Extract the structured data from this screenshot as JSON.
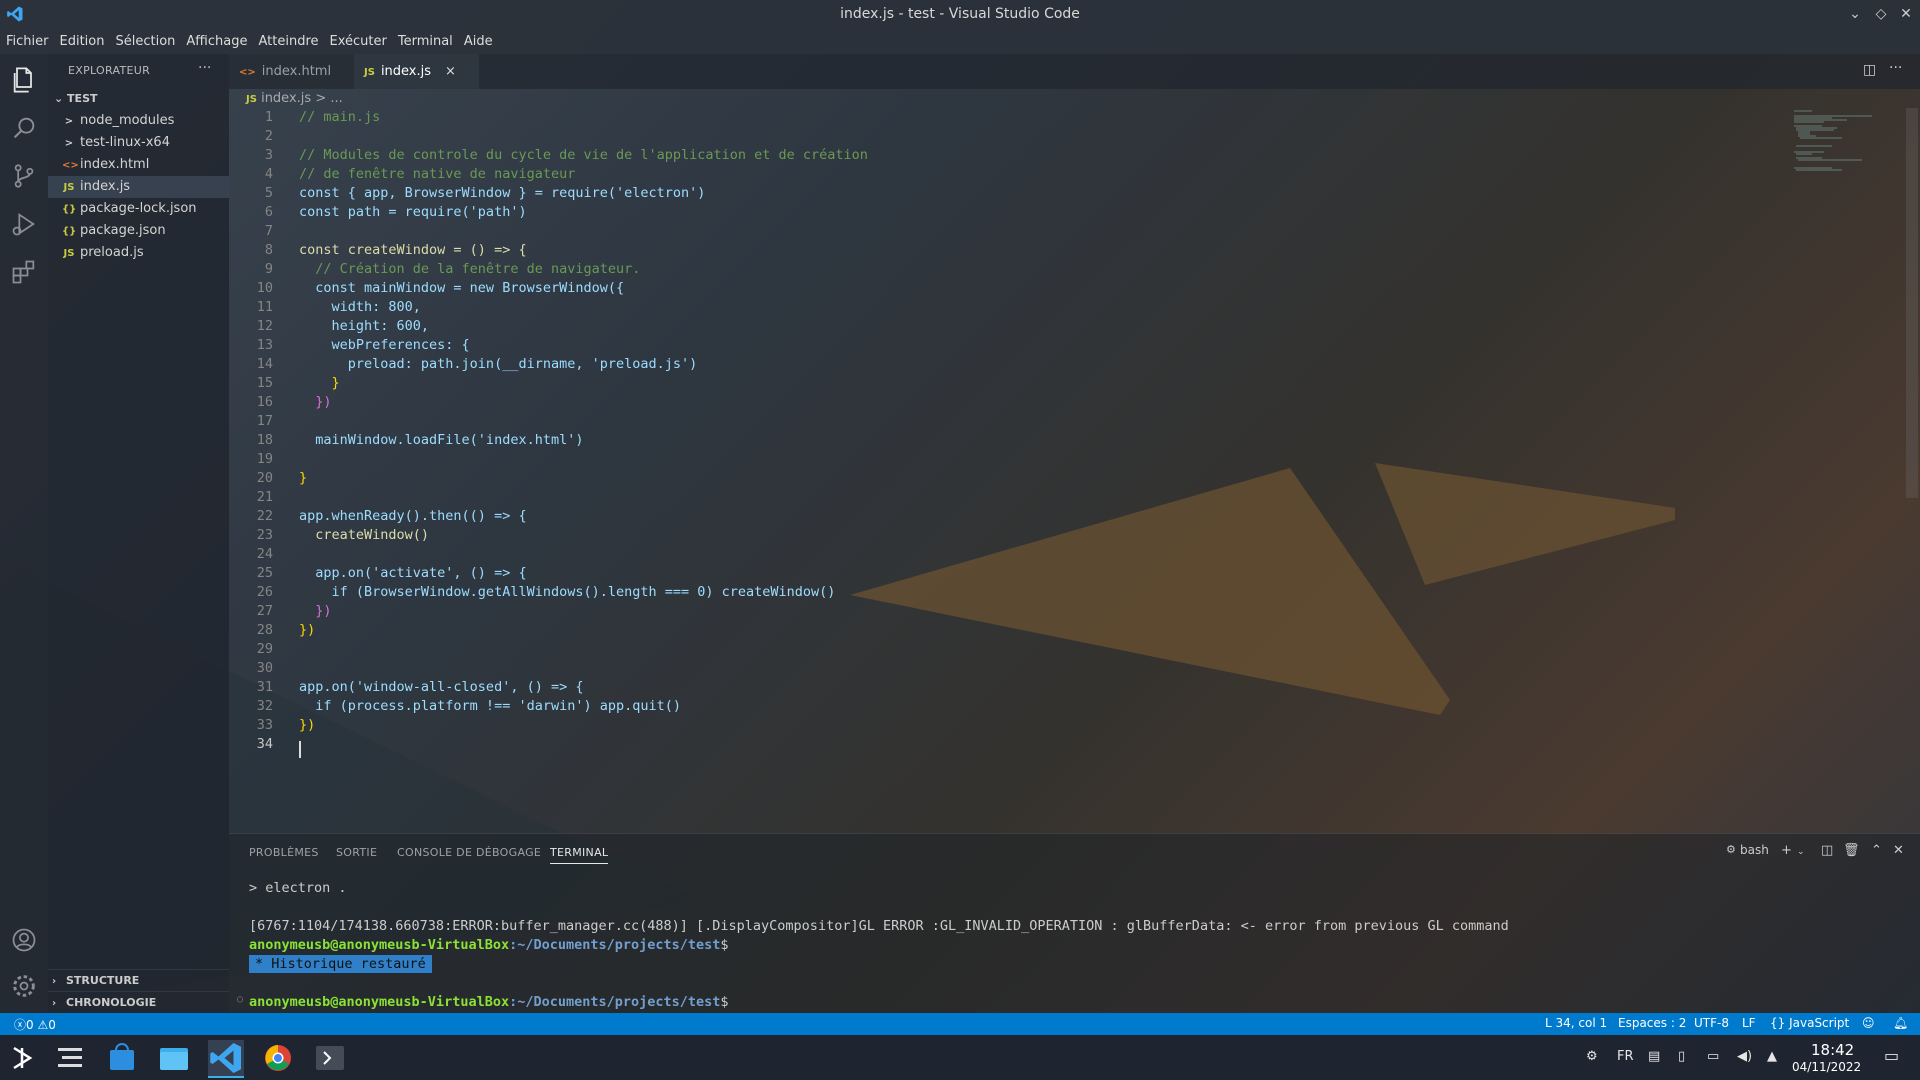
{
  "window": {
    "title": "index.js - test - Visual Studio Code",
    "controls": [
      "chevron-down",
      "restore",
      "close"
    ]
  },
  "menu": [
    "Fichier",
    "Edition",
    "Sélection",
    "Affichage",
    "Atteindre",
    "Exécuter",
    "Terminal",
    "Aide"
  ],
  "sidebar": {
    "title": "EXPLORATEUR",
    "more": "···",
    "folder": "TEST",
    "items": [
      {
        "label": "node_modules",
        "icon": ">",
        "type": "folder"
      },
      {
        "label": "test-linux-x64",
        "icon": ">",
        "type": "folder"
      },
      {
        "label": "index.html",
        "icon": "<>",
        "type": "html"
      },
      {
        "label": "index.js",
        "icon": "JS",
        "type": "js"
      },
      {
        "label": "package-lock.json",
        "icon": "{}",
        "type": "json"
      },
      {
        "label": "package.json",
        "icon": "{}",
        "type": "json"
      },
      {
        "label": "preload.js",
        "icon": "JS",
        "type": "js"
      }
    ],
    "sections": [
      "STRUCTURE",
      "CHRONOLOGIE"
    ]
  },
  "tabs": [
    {
      "label": "index.html",
      "icon": "<>",
      "active": false
    },
    {
      "label": "index.js",
      "icon": "JS",
      "active": true,
      "close": "×"
    }
  ],
  "breadcrumbs": {
    "icon": "JS",
    "file": "index.js",
    "sep": ">",
    "rest": "..."
  },
  "editor": {
    "current_line": 34,
    "lines": [
      {
        "n": "1",
        "t": "// main.js"
      },
      {
        "n": "2",
        "t": ""
      },
      {
        "n": "3",
        "t": "// Modules de controle du cycle de vie de l'application et de création"
      },
      {
        "n": "4",
        "t": "// de fenêtre native de navigateur"
      },
      {
        "n": "5",
        "t": "const { app, BrowserWindow } = require('electron')"
      },
      {
        "n": "6",
        "t": "const path = require('path')"
      },
      {
        "n": "7",
        "t": ""
      },
      {
        "n": "8",
        "t": "const createWindow = () => {"
      },
      {
        "n": "9",
        "t": "  // Création de la fenêtre de navigateur."
      },
      {
        "n": "10",
        "t": "  const mainWindow = new BrowserWindow({"
      },
      {
        "n": "11",
        "t": "    width: 800,"
      },
      {
        "n": "12",
        "t": "    height: 600,"
      },
      {
        "n": "13",
        "t": "    webPreferences: {"
      },
      {
        "n": "14",
        "t": "      preload: path.join(__dirname, 'preload.js')"
      },
      {
        "n": "15",
        "t": "    }"
      },
      {
        "n": "16",
        "t": "  })"
      },
      {
        "n": "17",
        "t": ""
      },
      {
        "n": "18",
        "t": "  mainWindow.loadFile('index.html')"
      },
      {
        "n": "19",
        "t": ""
      },
      {
        "n": "20",
        "t": "}"
      },
      {
        "n": "21",
        "t": ""
      },
      {
        "n": "22",
        "t": "app.whenReady().then(() => {"
      },
      {
        "n": "23",
        "t": "  createWindow()"
      },
      {
        "n": "24",
        "t": ""
      },
      {
        "n": "25",
        "t": "  app.on('activate', () => {"
      },
      {
        "n": "26",
        "t": "    if (BrowserWindow.getAllWindows().length === 0) createWindow()"
      },
      {
        "n": "27",
        "t": "  })"
      },
      {
        "n": "28",
        "t": "})"
      },
      {
        "n": "29",
        "t": ""
      },
      {
        "n": "30",
        "t": ""
      },
      {
        "n": "31",
        "t": "app.on('window-all-closed', () => {"
      },
      {
        "n": "32",
        "t": "  if (process.platform !== 'darwin') app.quit()"
      },
      {
        "n": "33",
        "t": "})"
      },
      {
        "n": "34",
        "t": ""
      }
    ]
  },
  "panel": {
    "tabs": [
      "PROBLÈMES",
      "SORTIE",
      "CONSOLE DE DÉBOGAGE",
      "TERMINAL"
    ],
    "active_tab": "TERMINAL",
    "shell": "bash",
    "terminal": {
      "line1": "> electron .",
      "error": "[6767:1104/174138.660738:ERROR:buffer_manager.cc(488)] [.DisplayCompositor]GL ERROR :GL_INVALID_OPERATION : glBufferData: <- error from previous GL command",
      "user": "anonymeusb@anonymeusb-VirtualBox",
      "path": ":~/Documents/projects/test",
      "dollar": "$",
      "restored_star": "*",
      "restored": "Historique restauré"
    }
  },
  "statusbar": {
    "errors": "0",
    "warnings": "0",
    "position": "L 34, col 1",
    "spaces": "Espaces : 2",
    "encoding": "UTF-8",
    "eol": "LF",
    "language": "JavaScript",
    "accent": "#007acc"
  },
  "taskbar": {
    "lang": "FR",
    "time": "18:42",
    "date": "04/11/2022"
  }
}
